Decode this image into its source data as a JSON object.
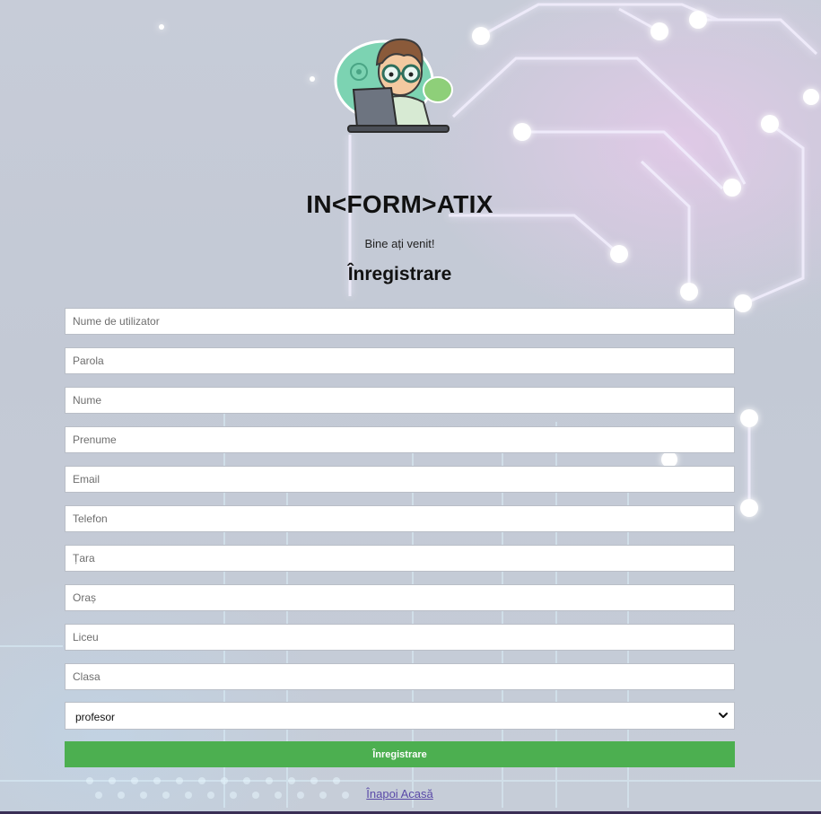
{
  "brand": "IN<FORM>ATIX",
  "welcome": "Bine ați venit!",
  "form_title": "Înregistrare",
  "fields": {
    "username": {
      "placeholder": "Nume de utilizator",
      "value": ""
    },
    "password": {
      "placeholder": "Parola",
      "value": ""
    },
    "last_name": {
      "placeholder": "Nume",
      "value": ""
    },
    "first_name": {
      "placeholder": "Prenume",
      "value": ""
    },
    "email": {
      "placeholder": "Email",
      "value": ""
    },
    "phone": {
      "placeholder": "Telefon",
      "value": ""
    },
    "country": {
      "placeholder": "Țara",
      "value": ""
    },
    "city": {
      "placeholder": "Oraș",
      "value": ""
    },
    "school": {
      "placeholder": "Liceu",
      "value": ""
    },
    "class": {
      "placeholder": "Clasa",
      "value": ""
    }
  },
  "role_select": {
    "selected": "profesor"
  },
  "submit_label": "Înregistrare",
  "back_link": "Înapoi Acasă",
  "colors": {
    "submit_bg": "#4caf50",
    "link": "#5a4aa8",
    "background": "#c5cbd6"
  },
  "icons": {
    "logo": "cartoon-programmer-at-laptop",
    "select_chevron": "chevron-down-icon"
  }
}
